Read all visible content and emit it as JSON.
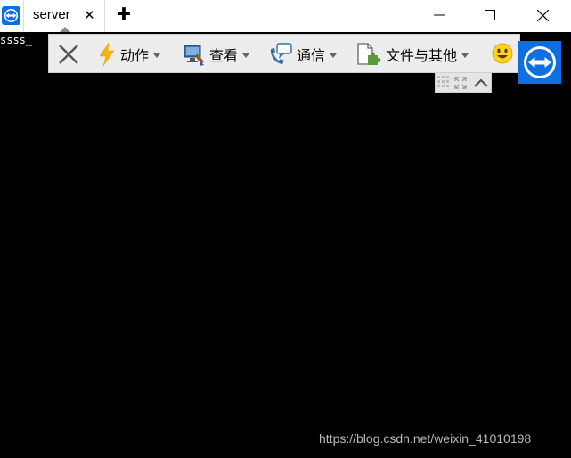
{
  "tabs": [
    {
      "label": "server",
      "close": "✕"
    }
  ],
  "new_tab": "✚",
  "terminal": {
    "line": "ssss_"
  },
  "toolbar": {
    "items": [
      {
        "label": "动作",
        "icon": "lightning-icon"
      },
      {
        "label": "查看",
        "icon": "monitor-brush-icon"
      },
      {
        "label": "通信",
        "icon": "phone-chat-icon"
      },
      {
        "label": "文件与其他",
        "icon": "file-puzzle-icon"
      }
    ]
  },
  "watermark": "https://blog.csdn.net/weixin_41010198",
  "colors": {
    "brand": "#0e6fe3",
    "toolbar_bg": "#ededed",
    "lightning": "#f4b400"
  }
}
